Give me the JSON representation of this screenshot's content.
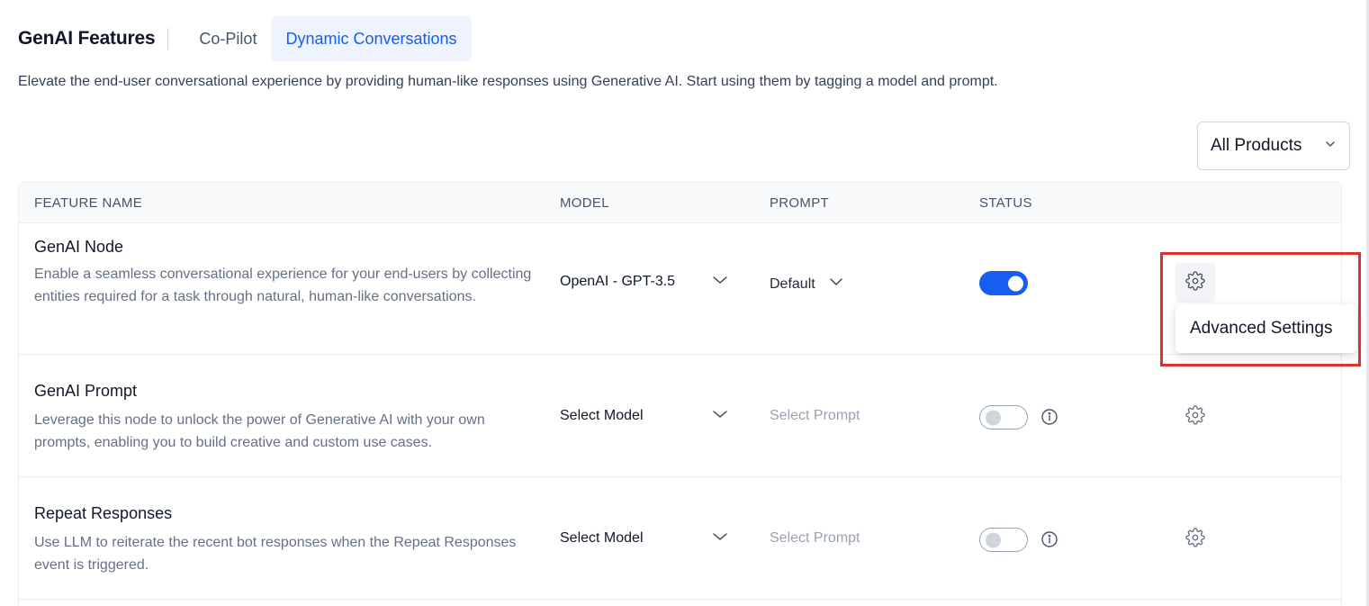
{
  "header": {
    "title": "GenAI Features",
    "tabs": [
      {
        "label": "Co-Pilot",
        "active": false
      },
      {
        "label": "Dynamic Conversations",
        "active": true
      }
    ]
  },
  "description": "Elevate the end-user conversational experience by providing human-like responses using Generative AI. Start using them by tagging a model and prompt.",
  "filter": {
    "selected": "All Products"
  },
  "table": {
    "columns": [
      "FEATURE NAME",
      "MODEL",
      "PROMPT",
      "STATUS"
    ],
    "rows": [
      {
        "name": "GenAI Node",
        "description": "Enable a seamless conversational experience for your end-users by collecting entities required for a task through natural, human-like conversations.",
        "model": "OpenAI - GPT-3.5",
        "prompt": "Default",
        "status": "on"
      },
      {
        "name": "GenAI Prompt",
        "description": "Leverage this node to unlock the power of Generative AI with your own prompts, enabling you to build creative and custom use cases.",
        "model": "Select Model",
        "prompt": "Select Prompt",
        "status": "off"
      },
      {
        "name": "Repeat Responses",
        "description": "Use LLM to reiterate the recent bot responses when the Repeat Responses event is triggered.",
        "model": "Select Model",
        "prompt": "Select Prompt",
        "status": "off"
      }
    ]
  },
  "tooltip": {
    "text": "Advanced Settings"
  },
  "colors": {
    "accent": "#155eef",
    "highlight": "#e03131",
    "tab_active_bg": "#eef4ff"
  },
  "icons": [
    "chevron-down-icon",
    "gear-icon",
    "info-icon"
  ]
}
